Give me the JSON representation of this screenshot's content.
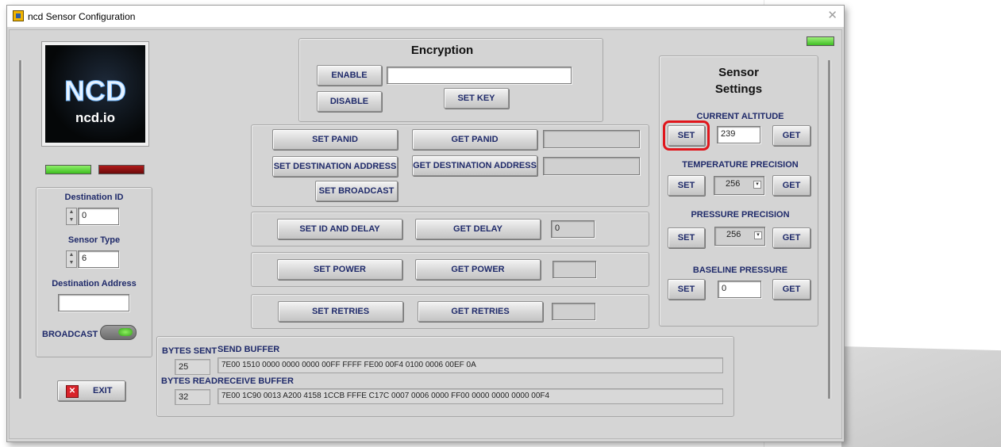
{
  "window": {
    "title": "ncd Sensor Configuration",
    "close": "✕"
  },
  "logo": {
    "text": "ncd.io"
  },
  "left": {
    "destination_id_label": "Destination ID",
    "destination_id_value": "0",
    "sensor_type_label": "Sensor Type",
    "sensor_type_value": "6",
    "destination_address_label": "Destination Address",
    "destination_address_value": "",
    "broadcast_label": "BROADCAST",
    "exit_label": "EXIT"
  },
  "encryption": {
    "title": "Encryption",
    "enable_label": "ENABLE",
    "disable_label": "DISABLE",
    "key_value": "",
    "set_key_label": "SET KEY"
  },
  "panid": {
    "set_panid_label": "SET PANID",
    "get_panid_label": "GET PANID",
    "panid_value": "",
    "set_dest_label": "SET DESTINATION ADDRESS",
    "get_dest_label": "GET DESTINATION ADDRESS",
    "dest_value": "",
    "set_broadcast_label": "SET BROADCAST"
  },
  "delay": {
    "set_label": "SET ID AND DELAY",
    "get_label": "GET DELAY",
    "value": "0"
  },
  "power": {
    "set_label": "SET POWER",
    "get_label": "GET POWER",
    "value": ""
  },
  "retries": {
    "set_label": "SET RETRIES",
    "get_label": "GET RETRIES",
    "value": ""
  },
  "buffers": {
    "bytes_sent_label": "BYTES SENT",
    "bytes_sent_value": "25",
    "send_buffer_label": "SEND BUFFER",
    "send_buffer_value": "7E00 1510 0000 0000 0000 00FF FFFF FE00 00F4 0100 0006 00EF 0A",
    "bytes_read_label": "BYTES READ",
    "bytes_read_value": "32",
    "receive_buffer_label": "RECEIVE BUFFER",
    "receive_buffer_value": "7E00 1C90 0013 A200 4158 1CCB FFFE C17C 0007 0006 0000 FF00 0000 0000 0000 00F4"
  },
  "sensor_settings": {
    "title_line1": "Sensor",
    "title_line2": "Settings",
    "current_altitude_label": "CURRENT ALTITUDE",
    "current_altitude_value": "239",
    "temperature_precision_label": "TEMPERATURE PRECISION",
    "temperature_precision_value": "256",
    "pressure_precision_label": "PRESSURE PRECISION",
    "pressure_precision_value": "256",
    "baseline_pressure_label": "BASELINE PRESSURE",
    "baseline_pressure_value": "0",
    "set_label": "SET",
    "get_label": "GET"
  },
  "colors": {
    "accent_text": "#1f2a6a",
    "led_green": "#4bd12a",
    "led_red": "#8a1010",
    "highlight": "#e0161c"
  }
}
